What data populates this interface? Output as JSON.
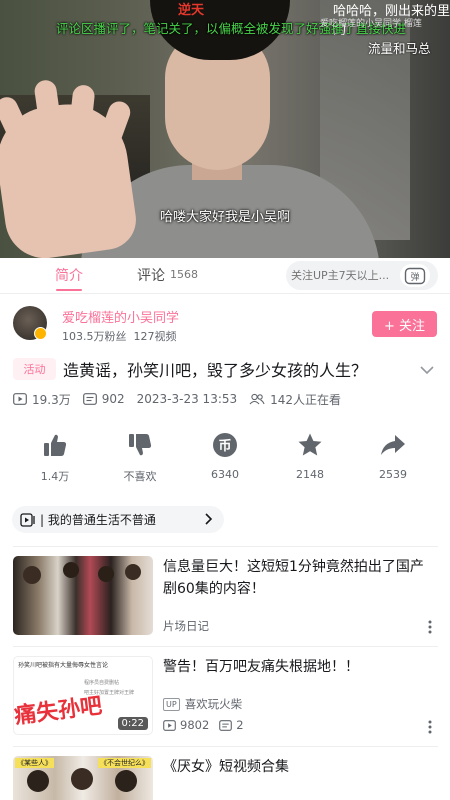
{
  "video": {
    "top_red_text": "逆天",
    "top_white_text": "哈哈哈，刚出来的里的",
    "caption_green": "评论区播评了，笔记关了，以偏概全被发现了好",
    "caption_green_2": "强推了直接快进",
    "caption_small": "爱吃榴莲的小吴同学 榴莲",
    "caption_white_right": "流量和马总",
    "subtitle": "哈喽大家好我是小吴啊"
  },
  "tabs": {
    "intro": "简介",
    "comments": "评论",
    "comment_count": "1568",
    "danmaku_placeholder": "关注UP主7天以上...",
    "danmaku_button": "弹"
  },
  "uploader": {
    "name": "爱吃榴莲的小吴同学",
    "fans": "103.5万粉丝",
    "videos": "127视频",
    "follow_label": "+ 关注"
  },
  "video_info": {
    "tag": "活动",
    "title": "造黄谣，孙笑川吧，毁了多少女孩的人生？",
    "plays": "19.3万",
    "danmaku_count": "902",
    "date": "2023-3-23 13:53",
    "watching": "142人正在看"
  },
  "actions": [
    {
      "label": "1.4万",
      "icon": "thumbs-up-icon"
    },
    {
      "label": "不喜欢",
      "icon": "thumbs-down-icon"
    },
    {
      "label": "6340",
      "icon": "coin-icon"
    },
    {
      "label": "2148",
      "icon": "star-icon"
    },
    {
      "label": "2539",
      "icon": "share-icon"
    }
  ],
  "collection": {
    "label": "| 我的普通生活不普通"
  },
  "recommendations": [
    {
      "title": "信息量巨大！这短短1分钟竟然拍出了国产剧60集的内容！",
      "uploader": "片场日记"
    },
    {
      "title": "警告！百万吧友痛失根据地！！",
      "uploader": "喜欢玩火柴",
      "plays": "9802",
      "danmaku": "2",
      "duration": "0:22",
      "thumb_caption": "痛失孙吧",
      "thumb_header": "孙笑川吧被指有大量侮辱女性言论",
      "thumb_lines": [
        "程序员自费删帖",
        "吧主好加置王牌对王牌"
      ]
    },
    {
      "title": "《厌女》短视频合集",
      "thumb_tags": [
        "《某些人》",
        "《不会世纪么》"
      ]
    }
  ],
  "colors": {
    "accent": "#fb7299",
    "text": "#18191c",
    "secondary": "#61666d",
    "badge": "#ffb400"
  }
}
